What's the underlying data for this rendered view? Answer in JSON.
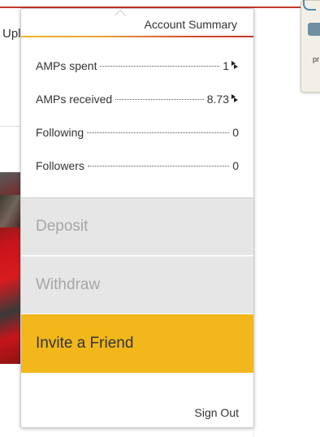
{
  "background": {
    "upload_partial": "Upl",
    "side_card_text": "pr"
  },
  "dropdown": {
    "title": "Account Summary",
    "stats": [
      {
        "label": "AMPs spent",
        "value": "1",
        "icon": "amp-icon"
      },
      {
        "label": "AMPs received",
        "value": "8.73",
        "icon": "amp-icon"
      },
      {
        "label": "Following",
        "value": "0"
      },
      {
        "label": "Followers",
        "value": "0"
      }
    ],
    "deposit_label": "Deposit",
    "withdraw_label": "Withdraw",
    "invite_label": "Invite a Friend",
    "signout_label": "Sign Out"
  },
  "colors": {
    "accent_yellow": "#f1b71b",
    "accent_red": "#c0392b",
    "disabled_bg": "#e6e6e6",
    "disabled_text": "#a6a6a6"
  }
}
